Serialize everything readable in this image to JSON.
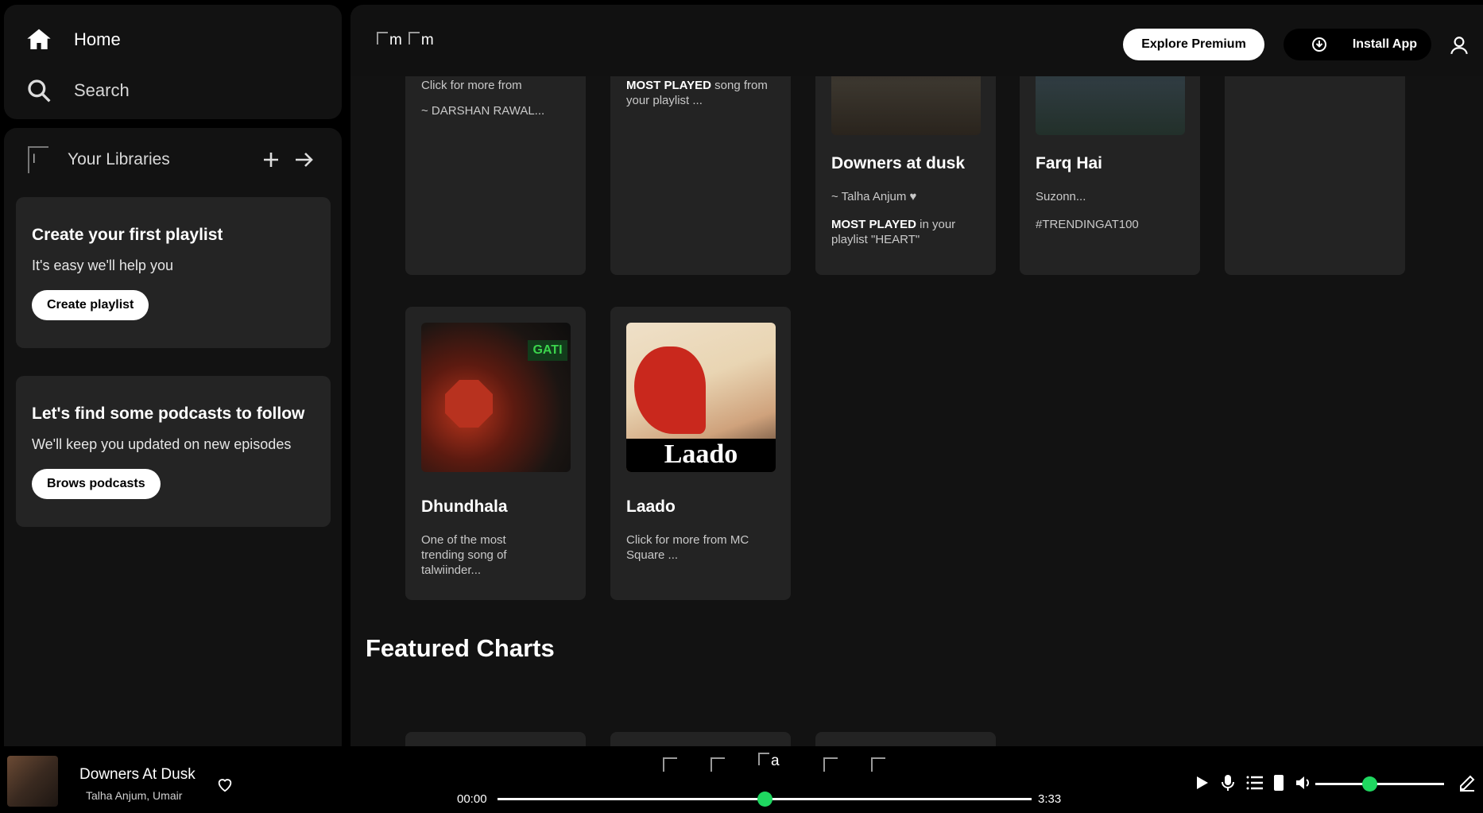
{
  "nav": {
    "home_label": "Home",
    "search_label": "Search"
  },
  "library": {
    "title": "Your Libraries",
    "broken_image_alt": "l",
    "playlist_card": {
      "title": "Create your first playlist",
      "subtitle": "It's easy we'll help you",
      "button_label": "Create playlist"
    },
    "podcast_card": {
      "title": "Let's find some podcasts to follow",
      "subtitle": "We'll keep you updated on new episodes",
      "button_label": "Brows podcasts"
    }
  },
  "topbar": {
    "back_alt": "m",
    "forward_alt": "m",
    "premium_label": "Explore Premium",
    "install_label": "Install App"
  },
  "cards_row1": [
    {
      "desc_lines": [
        "Click for more from",
        "",
        "~ DARSHAN RAWAL..."
      ]
    },
    {
      "desc_bold": "MOST PLAYED",
      "desc_rest": " song from your playlist ..."
    },
    {
      "title": "Downers at dusk",
      "sub": "~ Talha Anjum ♥",
      "desc_bold": "MOST PLAYED",
      "desc_rest": " in your playlist \"HEART\""
    },
    {
      "title": "Farq Hai",
      "sub": "Suzonn...",
      "desc": "#TRENDINGAT100"
    },
    {}
  ],
  "cards_row2": [
    {
      "title": "Dhundhala",
      "desc": "One of the most trending song of talwiinder...",
      "art_text": "GATI"
    },
    {
      "title": "Laado",
      "desc": "Click for more from MC Square ...",
      "art_text": "Laado"
    }
  ],
  "section": {
    "featured_title": "Featured Charts"
  },
  "player": {
    "track_title": "Downers At Dusk",
    "track_artist": "Talha Anjum, Umair",
    "center_alt": "a",
    "time_current": "00:00",
    "time_total": "3:33",
    "progress_fraction": 0.5,
    "volume_fraction": 0.42,
    "accent_color": "#1fd760"
  },
  "icons": [
    "home-icon",
    "search-icon",
    "library-icon",
    "plus-icon",
    "arrow-right-icon",
    "download-icon",
    "user-icon",
    "heart-icon",
    "play-icon",
    "mic-icon",
    "queue-icon",
    "device-icon",
    "volume-icon",
    "edit-icon"
  ]
}
